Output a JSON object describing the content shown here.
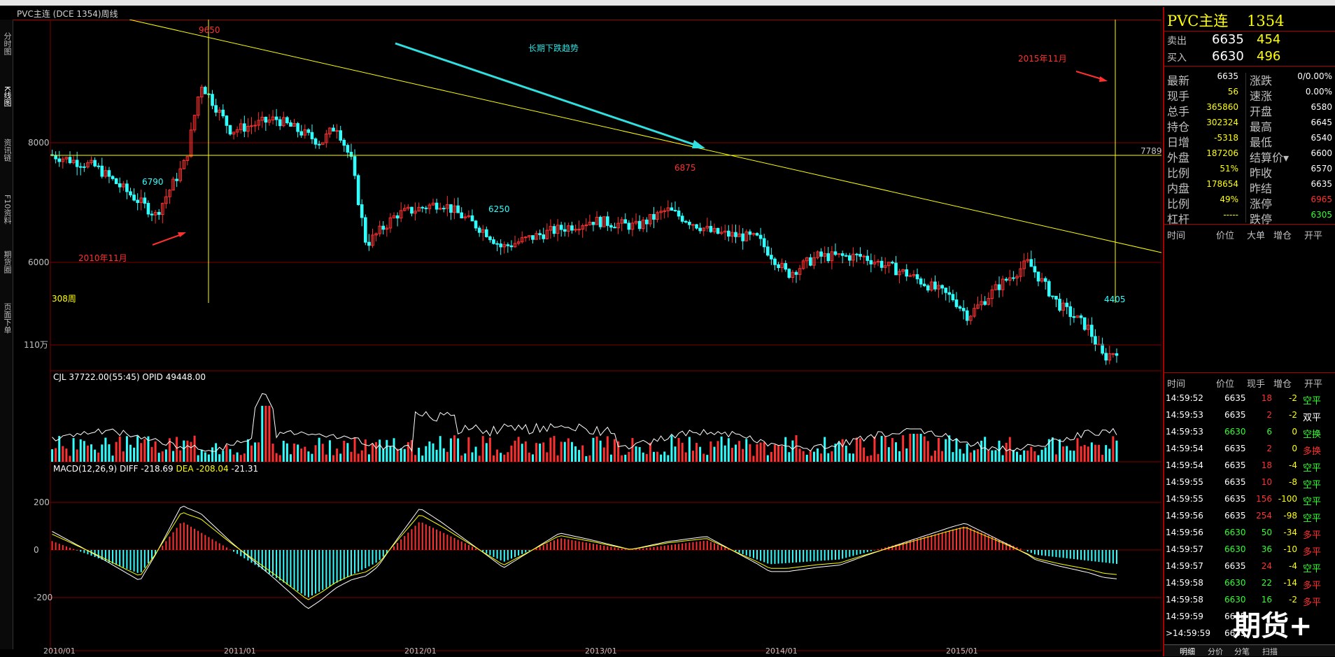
{
  "window": {
    "title": "PVC主连 (DCE 1354)周线"
  },
  "nav": {
    "items": [
      "分时图",
      "K线图",
      "资讯链",
      "F10资料",
      "期货圈",
      "页面下单"
    ],
    "active_index": 1
  },
  "chart": {
    "bars_label": "308周",
    "price_ticks": [
      "8000",
      "6000"
    ],
    "price_right_label": "7789",
    "annotations": {
      "trend_text": "长期下跌趋势",
      "left_date": "2010年11月",
      "right_date": "2015年11月",
      "high_label": "9650",
      "low1": "6790",
      "low2": "6250",
      "high2": "6875",
      "last_low": "4405"
    },
    "volume": {
      "header": "CJL  37722.00(55:45)   OPID  49448.00",
      "tick": "110万"
    },
    "macd": {
      "name": "MACD(12,26,9)",
      "diff_label": "DIFF",
      "diff_value": "-218.69",
      "dea_label": "DEA",
      "dea_value": "-208.04",
      "macd_value": "-21.31",
      "ticks": [
        "200",
        "0",
        "-200"
      ]
    },
    "x_labels": [
      "2010/01",
      "2011/01",
      "2012/01",
      "2013/01",
      "2014/01",
      "2015/01"
    ],
    "colors": {
      "up": "#ff3030",
      "down": "#30ffff",
      "trendline": "#ffff00",
      "arrow": "#30e0e0",
      "grid": "#800000"
    }
  },
  "chart_data": {
    "type": "candlestick-weekly",
    "symbol": "PVC主连",
    "x_range": [
      "2010/01",
      "2015/12"
    ],
    "y_ticks": [
      6000,
      8000
    ],
    "key_prices": [
      {
        "label": "9650",
        "kind": "high"
      },
      {
        "label": "6790",
        "kind": "low"
      },
      {
        "label": "6250",
        "kind": "low"
      },
      {
        "label": "6875",
        "kind": "high"
      },
      {
        "label": "4405",
        "kind": "low"
      }
    ],
    "approx_close_path": [
      [
        "2010/01",
        7800
      ],
      [
        "2010/04",
        7600
      ],
      [
        "2010/07",
        7000
      ],
      [
        "2010/08",
        6790
      ],
      [
        "2010/10",
        7700
      ],
      [
        "2010/11",
        9000
      ],
      [
        "2011/01",
        8200
      ],
      [
        "2011/04",
        8400
      ],
      [
        "2011/07",
        8000
      ],
      [
        "2011/08",
        8300
      ],
      [
        "2011/09",
        7700
      ],
      [
        "2011/10",
        6300
      ],
      [
        "2011/12",
        6800
      ],
      [
        "2012/03",
        7000
      ],
      [
        "2012/06",
        6500
      ],
      [
        "2012/07",
        6250
      ],
      [
        "2012/10",
        6500
      ],
      [
        "2013/01",
        6700
      ],
      [
        "2013/04",
        6600
      ],
      [
        "2013/06",
        6875
      ],
      [
        "2013/09",
        6500
      ],
      [
        "2013/12",
        6400
      ],
      [
        "2014/02",
        5800
      ],
      [
        "2014/04",
        6100
      ],
      [
        "2014/07",
        6100
      ],
      [
        "2014/10",
        5800
      ],
      [
        "2015/01",
        5400
      ],
      [
        "2015/02",
        5100
      ],
      [
        "2015/04",
        5600
      ],
      [
        "2015/06",
        6000
      ],
      [
        "2015/08",
        5300
      ],
      [
        "2015/10",
        4900
      ],
      [
        "2015/11",
        4405
      ],
      [
        "2015/12",
        4550
      ]
    ],
    "volume_ticks": [
      "110万"
    ],
    "macd_ticks": [
      200,
      0,
      -200
    ]
  },
  "quote": {
    "title_name": "PVC主连",
    "title_code": "1354",
    "sell": {
      "label": "卖出",
      "price": "6635",
      "qty": "454"
    },
    "buy": {
      "label": "买入",
      "price": "6630",
      "qty": "496"
    },
    "rows": [
      {
        "l1": "最新",
        "v1": "6635",
        "c1": "w",
        "l2": "涨跌",
        "v2": "0/0.00%",
        "c2": "w"
      },
      {
        "l1": "现手",
        "v1": "56",
        "c1": "y",
        "l2": "速涨",
        "v2": "0.00%",
        "c2": "w"
      },
      {
        "l1": "总手",
        "v1": "365860",
        "c1": "y",
        "l2": "开盘",
        "v2": "6580",
        "c2": "w"
      },
      {
        "l1": "持仓",
        "v1": "302324",
        "c1": "y",
        "l2": "最高",
        "v2": "6645",
        "c2": "w"
      },
      {
        "l1": "日增",
        "v1": "-5318",
        "c1": "y",
        "l2": "最低",
        "v2": "6540",
        "c2": "w"
      },
      {
        "l1": "外盘",
        "v1": "187206",
        "c1": "y",
        "l2": "结算价▾",
        "v2": "6600",
        "c2": "w"
      },
      {
        "l1": "比例",
        "v1": "51%",
        "c1": "y",
        "l2": "昨收",
        "v2": "6570",
        "c2": "w"
      },
      {
        "l1": "内盘",
        "v1": "178654",
        "c1": "y",
        "l2": "昨结",
        "v2": "6635",
        "c2": "w"
      },
      {
        "l1": "比例",
        "v1": "49%",
        "c1": "y",
        "l2": "涨停",
        "v2": "6965",
        "c2": "r"
      },
      {
        "l1": "杠杆",
        "v1": "-----",
        "c1": "y",
        "l2": "跌停",
        "v2": "6305",
        "c2": "g"
      }
    ],
    "big_header": [
      "时间",
      "价位",
      "大单",
      "增仓",
      "开平"
    ],
    "trades_header": [
      "时间",
      "价位",
      "现手",
      "增仓",
      "开平"
    ],
    "trades": [
      {
        "time": "14:59:52",
        "price": "6635",
        "pc": "w",
        "qty": "18",
        "qc": "r",
        "chg": "-2",
        "type": "空平",
        "tc": "g"
      },
      {
        "time": "14:59:53",
        "price": "6635",
        "pc": "w",
        "qty": "2",
        "qc": "r",
        "chg": "-2",
        "type": "双平",
        "tc": "w"
      },
      {
        "time": "14:59:53",
        "price": "6630",
        "pc": "g",
        "qty": "6",
        "qc": "g",
        "chg": "0",
        "type": "空换",
        "tc": "g"
      },
      {
        "time": "14:59:54",
        "price": "6635",
        "pc": "w",
        "qty": "2",
        "qc": "r",
        "chg": "0",
        "type": "多换",
        "tc": "r"
      },
      {
        "time": "14:59:54",
        "price": "6635",
        "pc": "w",
        "qty": "18",
        "qc": "r",
        "chg": "-4",
        "type": "空平",
        "tc": "g"
      },
      {
        "time": "14:59:55",
        "price": "6635",
        "pc": "w",
        "qty": "10",
        "qc": "r",
        "chg": "-8",
        "type": "空平",
        "tc": "g"
      },
      {
        "time": "14:59:55",
        "price": "6635",
        "pc": "w",
        "qty": "156",
        "qc": "r",
        "chg": "-100",
        "type": "空平",
        "tc": "g"
      },
      {
        "time": "14:59:56",
        "price": "6635",
        "pc": "w",
        "qty": "254",
        "qc": "r",
        "chg": "-98",
        "type": "空平",
        "tc": "g"
      },
      {
        "time": "14:59:56",
        "price": "6630",
        "pc": "g",
        "qty": "50",
        "qc": "g",
        "chg": "-34",
        "type": "多平",
        "tc": "r"
      },
      {
        "time": "14:59:57",
        "price": "6630",
        "pc": "g",
        "qty": "36",
        "qc": "g",
        "chg": "-10",
        "type": "多平",
        "tc": "r"
      },
      {
        "time": "14:59:57",
        "price": "6635",
        "pc": "w",
        "qty": "24",
        "qc": "r",
        "chg": "-4",
        "type": "空平",
        "tc": "g"
      },
      {
        "time": "14:59:58",
        "price": "6630",
        "pc": "g",
        "qty": "22",
        "qc": "g",
        "chg": "-14",
        "type": "多平",
        "tc": "r"
      },
      {
        "time": "14:59:58",
        "price": "6630",
        "pc": "g",
        "qty": "16",
        "qc": "g",
        "chg": "-2",
        "type": "多平",
        "tc": "r"
      },
      {
        "time": "14:59:59",
        "price": "6635",
        "pc": "w",
        "qty": "",
        "qc": "r",
        "chg": "",
        "type": "",
        "tc": "g"
      },
      {
        "time": ">14:59:59",
        "price": "6635",
        "pc": "w",
        "qty": "",
        "qc": "r",
        "chg": "",
        "type": "",
        "tc": "g"
      }
    ],
    "tabs": [
      "明细",
      "分价",
      "分笔",
      "扫描"
    ],
    "watermark": "期货+"
  }
}
